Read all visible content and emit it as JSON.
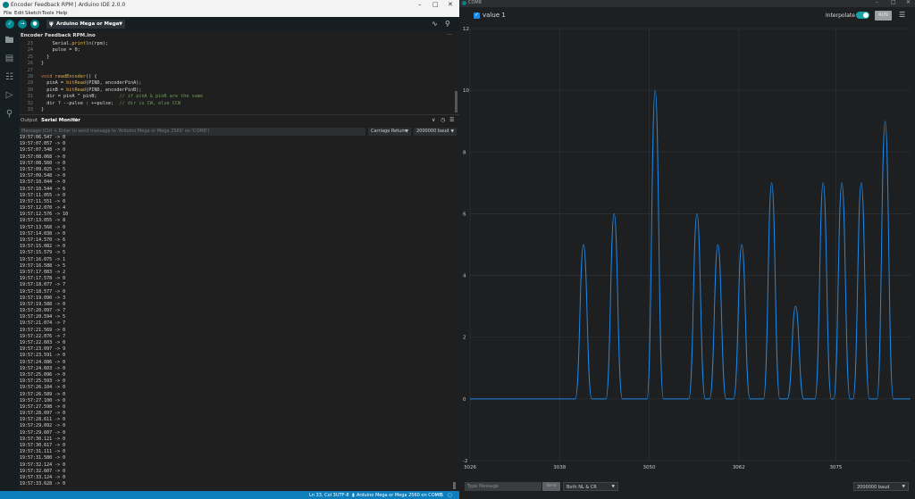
{
  "ide": {
    "window_title": "Encoder Feedback RPM | Arduino IDE 2.0.0",
    "menu": [
      "File",
      "Edit",
      "Sketch",
      "Tools",
      "Help"
    ],
    "board": "Arduino Mega or Mega ...",
    "file_tab": "Encoder Feedback RPM.ino",
    "code_lines": [
      {
        "n": "23",
        "text": "    Serial.println(rpm);"
      },
      {
        "n": "24",
        "text": "    pulse = 0;"
      },
      {
        "n": "25",
        "text": "  }"
      },
      {
        "n": "26",
        "text": "}"
      },
      {
        "n": "27",
        "text": ""
      },
      {
        "n": "28",
        "text": "void readEncoder() {"
      },
      {
        "n": "29",
        "text": "  pinA = bitRead(PIND, encoderPinA);"
      },
      {
        "n": "30",
        "text": "  pinB = bitRead(PIND, encoderPinB);"
      },
      {
        "n": "31",
        "text": "  dir = pinA ^ pinB;        // if pinA & pinB are the same"
      },
      {
        "n": "32",
        "text": "  dir ? --pulse : ++pulse;  // dir is CW, else CCW"
      },
      {
        "n": "33",
        "text": "}"
      }
    ],
    "panel_tabs": {
      "output": "Output",
      "serial_monitor": "Serial Monitor"
    },
    "message_placeholder": "Message (Ctrl + Enter to send message to 'Arduino Mega or Mega 2560' on 'COM8')",
    "line_ending": "Carriage Return",
    "baud": "2000000 baud",
    "serial_lines": [
      "19:57:06.547 -> 0",
      "19:57:07.057 -> 0",
      "19:57:07.548 -> 0",
      "19:57:08.068 -> 0",
      "19:57:08.560 -> 0",
      "19:57:09.025 -> 5",
      "19:57:09.548 -> 0",
      "19:57:10.044 -> 0",
      "19:57:10.544 -> 6",
      "19:57:11.055 -> 0",
      "19:57:11.551 -> 0",
      "19:57:12.070 -> 4",
      "19:57:12.576 -> 10",
      "19:57:13.055 -> 8",
      "19:57:13.568 -> 0",
      "19:57:14.038 -> 0",
      "19:57:14.570 -> 6",
      "19:57:15.082 -> 0",
      "19:57:15.579 -> 5",
      "19:57:16.075 -> 1",
      "19:57:16.588 -> 5",
      "19:57:17.083 -> 2",
      "19:57:17.578 -> 0",
      "19:57:18.077 -> 7",
      "19:57:18.577 -> 0",
      "19:57:19.090 -> 3",
      "19:57:19.588 -> 0",
      "19:57:20.097 -> 7",
      "19:57:20.594 -> 5",
      "19:57:21.074 -> 7",
      "19:57:21.569 -> 0",
      "19:57:22.076 -> 7",
      "19:57:22.603 -> 0",
      "19:57:23.097 -> 9",
      "19:57:23.591 -> 0",
      "19:57:24.086 -> 0",
      "19:57:24.603 -> 0",
      "19:57:25.096 -> 0",
      "19:57:25.593 -> 0",
      "19:57:26.104 -> 0",
      "19:57:26.589 -> 0",
      "19:57:27.100 -> 0",
      "19:57:27.598 -> 0",
      "19:57:28.097 -> 0",
      "19:57:28.611 -> 0",
      "19:57:29.092 -> 0",
      "19:57:29.607 -> 0",
      "19:57:30.121 -> 0",
      "19:57:30.617 -> 0",
      "19:57:31.111 -> 0",
      "19:57:31.580 -> 0",
      "19:57:32.124 -> 0",
      "19:57:32.607 -> 0",
      "19:57:33.124 -> 0",
      "19:57:33.628 -> 0"
    ],
    "status": {
      "position": "Ln 33, Col 3",
      "encoding": "UTF-8",
      "board_port": "Arduino Mega or Mega 2560 on COM8",
      "notifications": "5"
    }
  },
  "plotter": {
    "window_title": "COM8",
    "interpolate_label": "Interpolate",
    "interpolate_on": true,
    "run_label": "RUN",
    "message_placeholder": "Type Message",
    "send_label": "Send",
    "line_ending": "Both NL & CR",
    "baud": "2000000 baud",
    "colors": {
      "series": "#1e88e5",
      "grid": "#2c3033",
      "background": "#1d1f21"
    }
  },
  "chart_data": {
    "type": "line",
    "series": [
      {
        "name": "value 1",
        "peaks": [
          [
            3041.2,
            5
          ],
          [
            3045.3,
            6
          ],
          [
            3050.8,
            10
          ],
          [
            3056.4,
            6
          ],
          [
            3059.2,
            5
          ],
          [
            3062.4,
            5
          ],
          [
            3066.4,
            7
          ],
          [
            3069.6,
            3
          ],
          [
            3073.3,
            7
          ],
          [
            3075.8,
            7
          ],
          [
            3078.4,
            7
          ],
          [
            3081.6,
            9
          ]
        ]
      }
    ],
    "x_ticks": [
      3026,
      3038,
      3050,
      3062,
      3075
    ],
    "y_ticks": [
      -2,
      0,
      2,
      4,
      6,
      8,
      10,
      12
    ],
    "xlim": [
      3026,
      3085
    ],
    "ylim": [
      -2,
      12
    ],
    "grid": true,
    "legend_position": "top-left"
  }
}
